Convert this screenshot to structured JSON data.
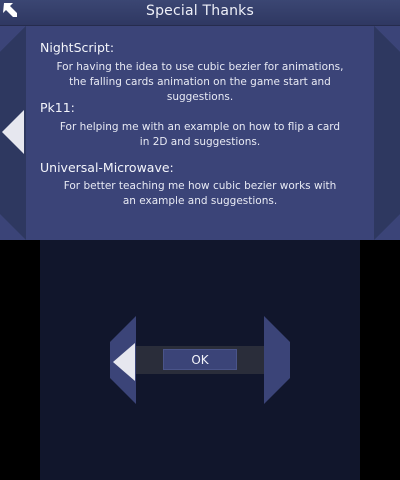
{
  "header": {
    "title": "Special Thanks"
  },
  "credits": [
    {
      "name": "NightScript:",
      "description_lines": [
        "For having the idea to use cubic bezier for animations,",
        "the falling cards animation on the game start and",
        "suggestions."
      ]
    },
    {
      "name": "Pk11:",
      "description_lines": [
        "For helping me with an example on how to flip a card",
        "in 2D and suggestions."
      ]
    },
    {
      "name": "Universal-Microwave:",
      "description_lines": [
        "For better teaching me how cubic bezier works with",
        "an example and suggestions."
      ]
    }
  ],
  "dialog": {
    "ok_label": "OK"
  },
  "icons": {
    "back": "back-arrow-icon",
    "page_left": "arrow-left-icon",
    "bottom_left": "arrow-left-icon"
  },
  "colors": {
    "panel": "#3b4478",
    "title_bar": "#333d6a",
    "bottom_panel": "#11162c",
    "text": "#f2f3f9"
  }
}
